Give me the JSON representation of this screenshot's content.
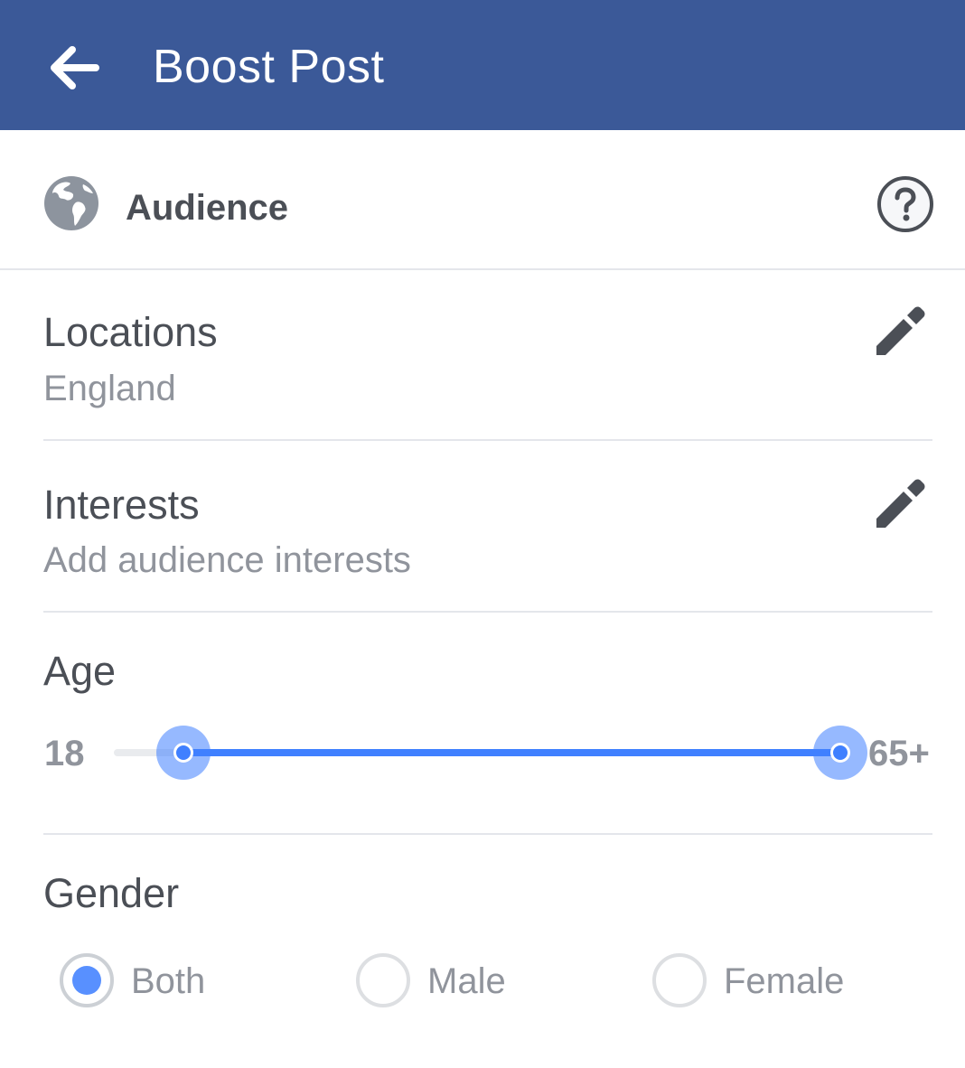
{
  "header": {
    "title": "Boost Post",
    "background_color": "#3b5998",
    "back_icon": "back-arrow-icon"
  },
  "audience": {
    "title": "Audience",
    "icon": "globe-icon",
    "help_icon": "help-icon"
  },
  "locations": {
    "title": "Locations",
    "value": "England",
    "edit_icon": "pencil-icon"
  },
  "interests": {
    "title": "Interests",
    "placeholder": "Add audience interests",
    "edit_icon": "pencil-icon"
  },
  "age": {
    "title": "Age",
    "min_label": "18",
    "max_label": "65+",
    "selected_min": "18",
    "selected_max": "65+",
    "accent_color": "#4080ff"
  },
  "gender": {
    "title": "Gender",
    "options": [
      {
        "label": "Both",
        "selected": true
      },
      {
        "label": "Male",
        "selected": false
      },
      {
        "label": "Female",
        "selected": false
      }
    ]
  }
}
